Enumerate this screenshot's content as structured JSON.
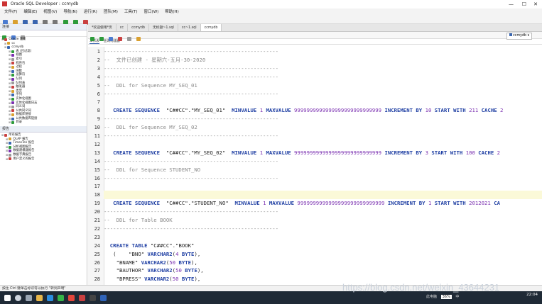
{
  "window": {
    "title": "Oracle SQL Developer : ccmydb"
  },
  "menu": [
    "文件(F)",
    "编辑(E)",
    "视图(V)",
    "导航(N)",
    "运行(R)",
    "团队(M)",
    "工具(T)",
    "窗口(W)",
    "帮助(H)"
  ],
  "left": {
    "connections_header": "连接",
    "tree": [
      "Oracle 连接",
      "cc",
      "ccmydb",
      "表 (已过滤)",
      "视图",
      "索引",
      "程序包",
      "过程",
      "函数",
      "运算符",
      "队列",
      "队列表",
      "触发器",
      "类型",
      "序列",
      "实体化视图",
      "实体化视图日志",
      "同义词",
      "公共同义词",
      "数据库链接",
      "公共数据库链接",
      "目录"
    ],
    "reports_header": "报告",
    "reports": [
      "所有报告",
      "OLAP 报告",
      "TimesTen 报告",
      "分析视图报告",
      "数据建模器报告",
      "数据字典报告",
      "用户定义的报告"
    ]
  },
  "tabs": [
    "*欢迎使用*页",
    "cc",
    "ccmydb",
    "无标题~1.sql",
    "cc~1.sql",
    "ccmydb"
  ],
  "subtabs": [
    "工作表",
    "查询构建器"
  ],
  "connection_select": "ccmydb",
  "code_lines": [
    [
      [
        "cm",
        "--------------------------------------------------------"
      ]
    ],
    [
      [
        "cm",
        "--  文件已创建 - 星期六-五月-30-2020   "
      ]
    ],
    [
      [
        "cm",
        "--------------------------------------------------------"
      ]
    ],
    [
      [
        "cm",
        "--------------------------------------------------------"
      ]
    ],
    [
      [
        "cm",
        "--  DDL for Sequence MY_SEQ_01"
      ]
    ],
    [
      [
        "cm",
        "--------------------------------------------------------"
      ]
    ],
    [],
    [
      [
        "kw",
        "   CREATE SEQUENCE  "
      ],
      [
        "str",
        "\"C##CC\".\"MY_SEQ_01\"  "
      ],
      [
        "kw",
        "MINVALUE "
      ],
      [
        "num",
        "1 "
      ],
      [
        "kw",
        "MAXVALUE "
      ],
      [
        "num",
        "9999999999999999999999999999 "
      ],
      [
        "kw",
        "INCREMENT BY "
      ],
      [
        "num",
        "10 "
      ],
      [
        "kw",
        "START WITH "
      ],
      [
        "num",
        "211 "
      ],
      [
        "kw",
        "CACHE "
      ],
      [
        "num",
        "2"
      ]
    ],
    [
      [
        "cm",
        "--------------------------------------------------------"
      ]
    ],
    [
      [
        "cm",
        "--  DDL for Sequence MY_SEQ_02"
      ]
    ],
    [
      [
        "cm",
        "--------------------------------------------------------"
      ]
    ],
    [],
    [
      [
        "kw",
        "   CREATE SEQUENCE  "
      ],
      [
        "str",
        "\"C##CC\".\"MY_SEQ_02\"  "
      ],
      [
        "kw",
        "MINVALUE "
      ],
      [
        "num",
        "1 "
      ],
      [
        "kw",
        "MAXVALUE "
      ],
      [
        "num",
        "9999999999999999999999999999 "
      ],
      [
        "kw",
        "INCREMENT BY "
      ],
      [
        "num",
        "3 "
      ],
      [
        "kw",
        "START WITH "
      ],
      [
        "num",
        "100 "
      ],
      [
        "kw",
        "CACHE "
      ],
      [
        "num",
        "2"
      ]
    ],
    [
      [
        "cm",
        "--------------------------------------------------------"
      ]
    ],
    [
      [
        "cm",
        "--  DDL for Sequence STUDENT_NO"
      ]
    ],
    [
      [
        "cm",
        "--------------------------------------------------------"
      ]
    ],
    [],
    [
      [
        "hl",
        ""
      ]
    ],
    [
      [
        "kw",
        "   CREATE SEQUENCE  "
      ],
      [
        "str",
        "\"C##CC\".\"STUDENT_NO\"  "
      ],
      [
        "kw",
        "MINVALUE "
      ],
      [
        "num",
        "1 "
      ],
      [
        "kw",
        "MAXVALUE "
      ],
      [
        "num",
        "9999999999999999999999999999 "
      ],
      [
        "kw",
        "INCREMENT BY "
      ],
      [
        "num",
        "1 "
      ],
      [
        "kw",
        "START WITH "
      ],
      [
        "num",
        "2012021 "
      ],
      [
        "kw",
        "CA"
      ]
    ],
    [
      [
        "cm",
        "--------------------------------------------------------"
      ]
    ],
    [
      [
        "cm",
        "--  DDL for Table BOOK"
      ]
    ],
    [
      [
        "cm",
        "--------------------------------------------------------"
      ]
    ],
    [],
    [
      [
        "kw",
        "  CREATE TABLE "
      ],
      [
        "str",
        "\"C##CC\".\"BOOK\""
      ]
    ],
    [
      [
        "str",
        "   (    \"BNO\" "
      ],
      [
        "kw",
        "VARCHAR2"
      ],
      [
        "str",
        "("
      ],
      [
        "num",
        "4 "
      ],
      [
        "kw",
        "BYTE"
      ],
      [
        "str",
        "),"
      ]
    ],
    [
      [
        "str",
        "    \"BNAME\" "
      ],
      [
        "kw",
        "VARCHAR2"
      ],
      [
        "str",
        "("
      ],
      [
        "num",
        "50 "
      ],
      [
        "kw",
        "BYTE"
      ],
      [
        "str",
        "),"
      ]
    ],
    [
      [
        "str",
        "    \"BAUTHOR\" "
      ],
      [
        "kw",
        "VARCHAR2"
      ],
      [
        "str",
        "("
      ],
      [
        "num",
        "50 "
      ],
      [
        "kw",
        "BYTE"
      ],
      [
        "str",
        "),"
      ]
    ],
    [
      [
        "str",
        "    \"BPRESS\" "
      ],
      [
        "kw",
        "VARCHAR2"
      ],
      [
        "str",
        "("
      ],
      [
        "num",
        "50 "
      ],
      [
        "kw",
        "BYTE"
      ],
      [
        "str",
        "),"
      ]
    ]
  ],
  "status": "按住 Ctrl 键单击标识符以执行 \"转到声明\"",
  "watermark": "https://blog.csdn.net/weixin_43644231",
  "tray": {
    "lang": "此电脑",
    "battery": "36%",
    "ime": "中",
    "time": "22:04"
  },
  "colors": {
    "comment": "#8a8a8a",
    "keyword": "#1f3fa3",
    "number": "#7a2fb0",
    "taskbar": "#1f2a36"
  }
}
